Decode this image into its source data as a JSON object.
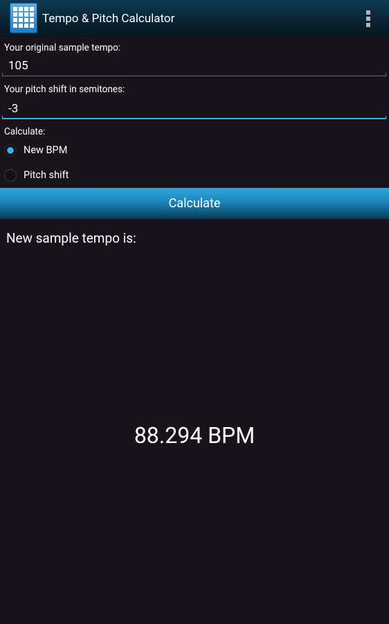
{
  "action_bar": {
    "title": "Tempo & Pitch Calculator",
    "app_icon": "grid-app-icon",
    "overflow_icon": "overflow-menu-icon"
  },
  "form": {
    "tempo_label": "Your original sample tempo:",
    "tempo_value": "105",
    "pitch_label": "Your pitch shift in semitones:",
    "pitch_value": "-3",
    "calculate_label": "Calculate:",
    "options": [
      {
        "label": "New BPM",
        "checked": true
      },
      {
        "label": "Pitch shift",
        "checked": false
      }
    ]
  },
  "button": {
    "label": "Calculate"
  },
  "result": {
    "label": "New sample tempo is:",
    "value": "88.294 BPM"
  },
  "colors": {
    "accent": "#33b5e5",
    "background": "#19141b",
    "action_bar": "#0a2434"
  }
}
